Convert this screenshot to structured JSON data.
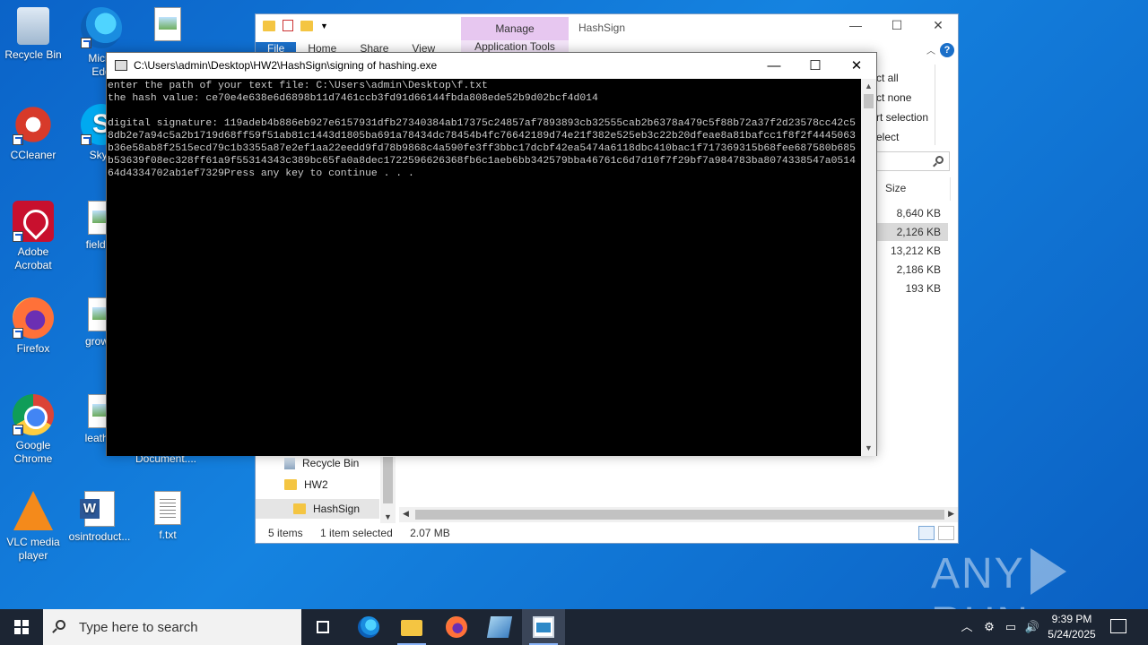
{
  "desktop": {
    "icons": [
      {
        "label": "Recycle Bin",
        "icon": "recycle-bin-icon"
      },
      {
        "label": "Micro\nEdg",
        "icon": "edge-icon"
      },
      {
        "label": "CCleaner",
        "icon": "ccleaner-icon"
      },
      {
        "label": "Skyp",
        "icon": "skype-icon"
      },
      {
        "label": "Adobe\nAcrobat",
        "icon": "acrobat-icon"
      },
      {
        "label": "fieldsn",
        "icon": "image-file-icon"
      },
      {
        "label": "Firefox",
        "icon": "firefox-icon"
      },
      {
        "label": "growth",
        "icon": "image-file-icon"
      },
      {
        "label": "Google\nChrome",
        "icon": "chrome-icon"
      },
      {
        "label": "leather",
        "icon": "image-file-icon"
      },
      {
        "label": "Document....",
        "icon": "document-icon"
      },
      {
        "label": "VLC media\nplayer",
        "icon": "vlc-icon"
      },
      {
        "label": "osintroduct...",
        "icon": "word-icon"
      },
      {
        "label": "f.txt",
        "icon": "text-file-icon"
      }
    ]
  },
  "explorer": {
    "title": "HashSign",
    "manage_tab": "Manage",
    "app_tools": "Application Tools",
    "ribbon_tabs": [
      "File",
      "Home",
      "Share",
      "View"
    ],
    "ribbon_peek": [
      "ct all",
      "ct none",
      "rt selection",
      "elect"
    ],
    "column_size": "Size",
    "sizes": [
      "8,640 KB",
      "2,126 KB",
      "13,212 KB",
      "2,186 KB",
      "193 KB"
    ],
    "selected_index": 1,
    "nav": [
      {
        "label": "Recycle Bin",
        "icon": "recycle-bin-icon"
      },
      {
        "label": "HW2",
        "icon": "folder-icon"
      },
      {
        "label": "HashSign",
        "icon": "folder-icon"
      }
    ],
    "status": {
      "items": "5 items",
      "selected": "1 item selected",
      "size": "2.07 MB"
    },
    "controls": {
      "minimize": "—",
      "maximize": "☐",
      "close": "✕"
    }
  },
  "console": {
    "title": "C:\\Users\\admin\\Desktop\\HW2\\HashSign\\signing of hashing.exe",
    "output": "enter the path of your text file: C:\\Users\\admin\\Desktop\\f.txt\nthe hash value: ce70e4e638e6d6898b11d7461ccb3fd91d66144fbda808ede52b9d02bcf4d014\n\ndigital signature: 119adeb4b886eb927e6157931dfb27340384ab17375c24857af7893893cb32555cab2b6378a479c5f88b72a37f2d23578cc42c58db2e7a94c5a2b1719d68ff59f51ab81c1443d1805ba691a78434dc78454b4fc76642189d74e21f382e525eb3c22b20dfeae8a81bafcc1f8f2f4445063b36e58ab8f2515ecd79c1b3355a87e2ef1aa22eedd9fd78b9868c4a590fe3ff3bbc17dcbf42ea5474a6118dbc410bac1f717369315b68fee687580b685b53639f08ec328ff61a9f55314343c389bc65fa0a8dec1722596626368fb6c1aeb6bb342579bba46761c6d7d10f7f29bf7a984783ba8074338547a051464d4334702ab1ef7329Press any key to continue . . .",
    "controls": {
      "minimize": "—",
      "maximize": "☐",
      "close": "✕"
    }
  },
  "taskbar": {
    "search_placeholder": "Type here to search",
    "time": "9:39 PM",
    "date": "5/24/2025",
    "apps": [
      "task-view-icon",
      "edge-icon",
      "file-explorer-icon",
      "firefox-icon",
      "app-icon",
      "console-icon"
    ]
  },
  "watermark": {
    "left": "ANY",
    "right": "RUN"
  }
}
